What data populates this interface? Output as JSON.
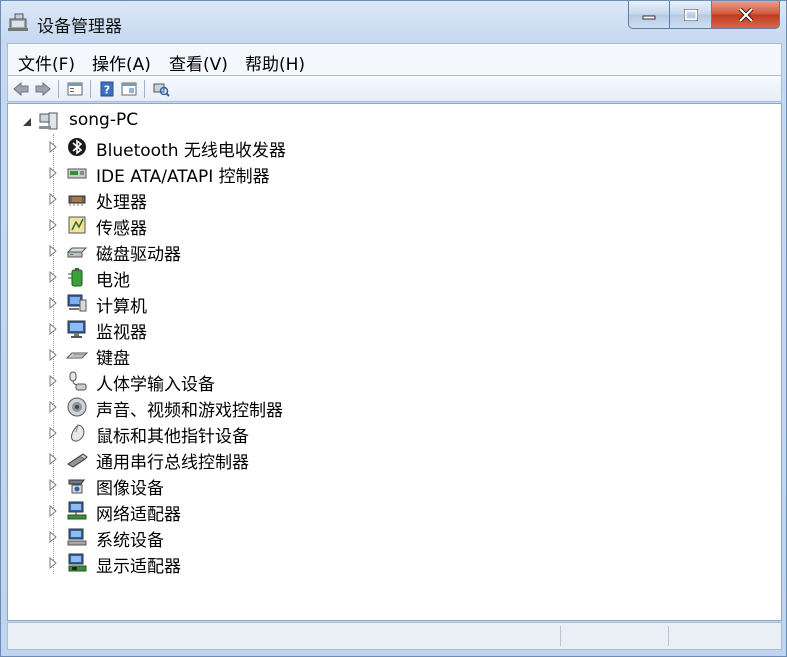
{
  "window": {
    "title": "设备管理器"
  },
  "menu": [
    "文件(F)",
    "操作(A)",
    "查看(V)",
    "帮助(H)"
  ],
  "toolbar": [
    "back-arrow",
    "forward-arrow",
    "properties",
    "help",
    "scan",
    "update"
  ],
  "tree": {
    "root": "song-PC",
    "items": [
      {
        "label": "Bluetooth 无线电收发器",
        "icon": "bluetooth-icon"
      },
      {
        "label": "IDE ATA/ATAPI 控制器",
        "icon": "ide-controller-icon"
      },
      {
        "label": "处理器",
        "icon": "processor-icon"
      },
      {
        "label": "传感器",
        "icon": "sensor-icon"
      },
      {
        "label": "磁盘驱动器",
        "icon": "disk-drive-icon"
      },
      {
        "label": "电池",
        "icon": "battery-icon"
      },
      {
        "label": "计算机",
        "icon": "computer-icon"
      },
      {
        "label": "监视器",
        "icon": "monitor-icon"
      },
      {
        "label": "键盘",
        "icon": "keyboard-icon"
      },
      {
        "label": "人体学输入设备",
        "icon": "hid-icon"
      },
      {
        "label": "声音、视频和游戏控制器",
        "icon": "sound-icon"
      },
      {
        "label": "鼠标和其他指针设备",
        "icon": "mouse-icon"
      },
      {
        "label": "通用串行总线控制器",
        "icon": "usb-icon"
      },
      {
        "label": "图像设备",
        "icon": "imaging-icon"
      },
      {
        "label": "网络适配器",
        "icon": "network-adapter-icon"
      },
      {
        "label": "系统设备",
        "icon": "system-device-icon"
      },
      {
        "label": "显示适配器",
        "icon": "display-adapter-icon"
      }
    ]
  }
}
